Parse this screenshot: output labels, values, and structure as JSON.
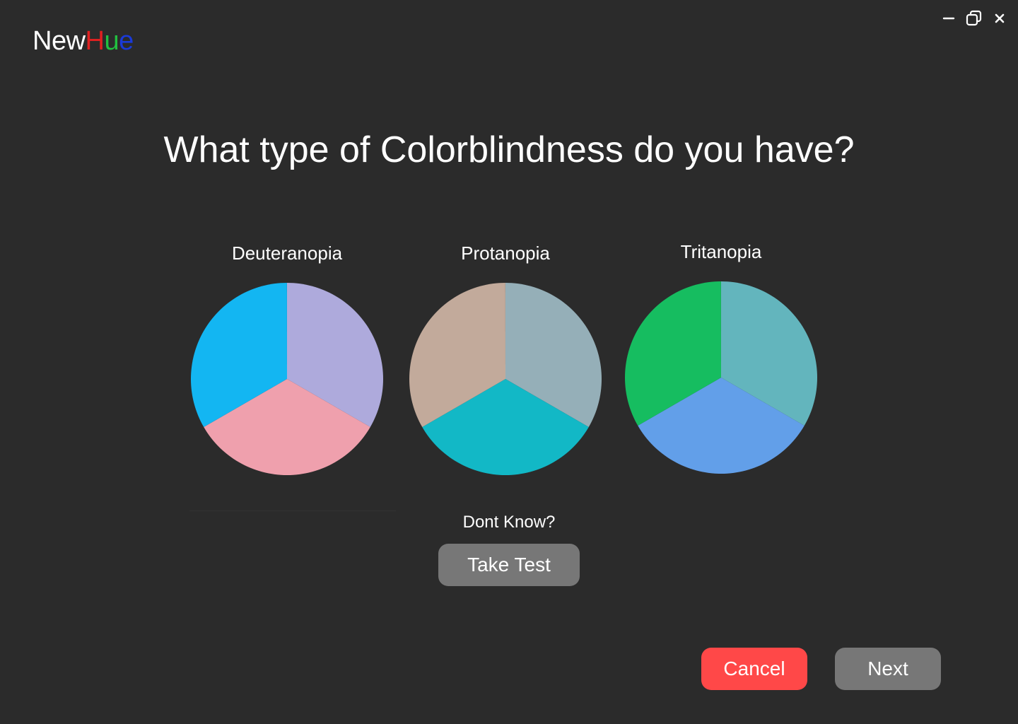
{
  "app": {
    "logo_parts": [
      {
        "text": "New",
        "color": "#ffffff"
      },
      {
        "text": "H",
        "color": "#e02020"
      },
      {
        "text": "u",
        "color": "#22c040"
      },
      {
        "text": "e",
        "color": "#1a3ad8"
      }
    ]
  },
  "window_controls": {
    "minimize_icon": "minimize-icon",
    "restore_icon": "restore-icon",
    "close_icon": "close-icon"
  },
  "heading": "What type of Colorblindness do you have?",
  "options": [
    {
      "label": "Deuteranopia",
      "slices": [
        {
          "color": "#aeaadc",
          "fraction": 0.3333
        },
        {
          "color": "#efa0ad",
          "fraction": 0.3333
        },
        {
          "color": "#13b6f2",
          "fraction": 0.3333
        }
      ]
    },
    {
      "label": "Protanopia",
      "slices": [
        {
          "color": "#95afb8",
          "fraction": 0.3333
        },
        {
          "color": "#12b8c6",
          "fraction": 0.3333
        },
        {
          "color": "#c2aa9b",
          "fraction": 0.3333
        }
      ]
    },
    {
      "label": "Tritanopia",
      "slices": [
        {
          "color": "#63b5bd",
          "fraction": 0.3333
        },
        {
          "color": "#629fe9",
          "fraction": 0.3333
        },
        {
          "color": "#16bd60",
          "fraction": 0.3333
        }
      ]
    }
  ],
  "dont_know": "Dont Know?",
  "buttons": {
    "take_test": "Take Test",
    "cancel": "Cancel",
    "next": "Next"
  },
  "colors": {
    "background": "#2b2b2b",
    "cancel_bg": "#ff4848",
    "neutral_bg": "#777777"
  }
}
